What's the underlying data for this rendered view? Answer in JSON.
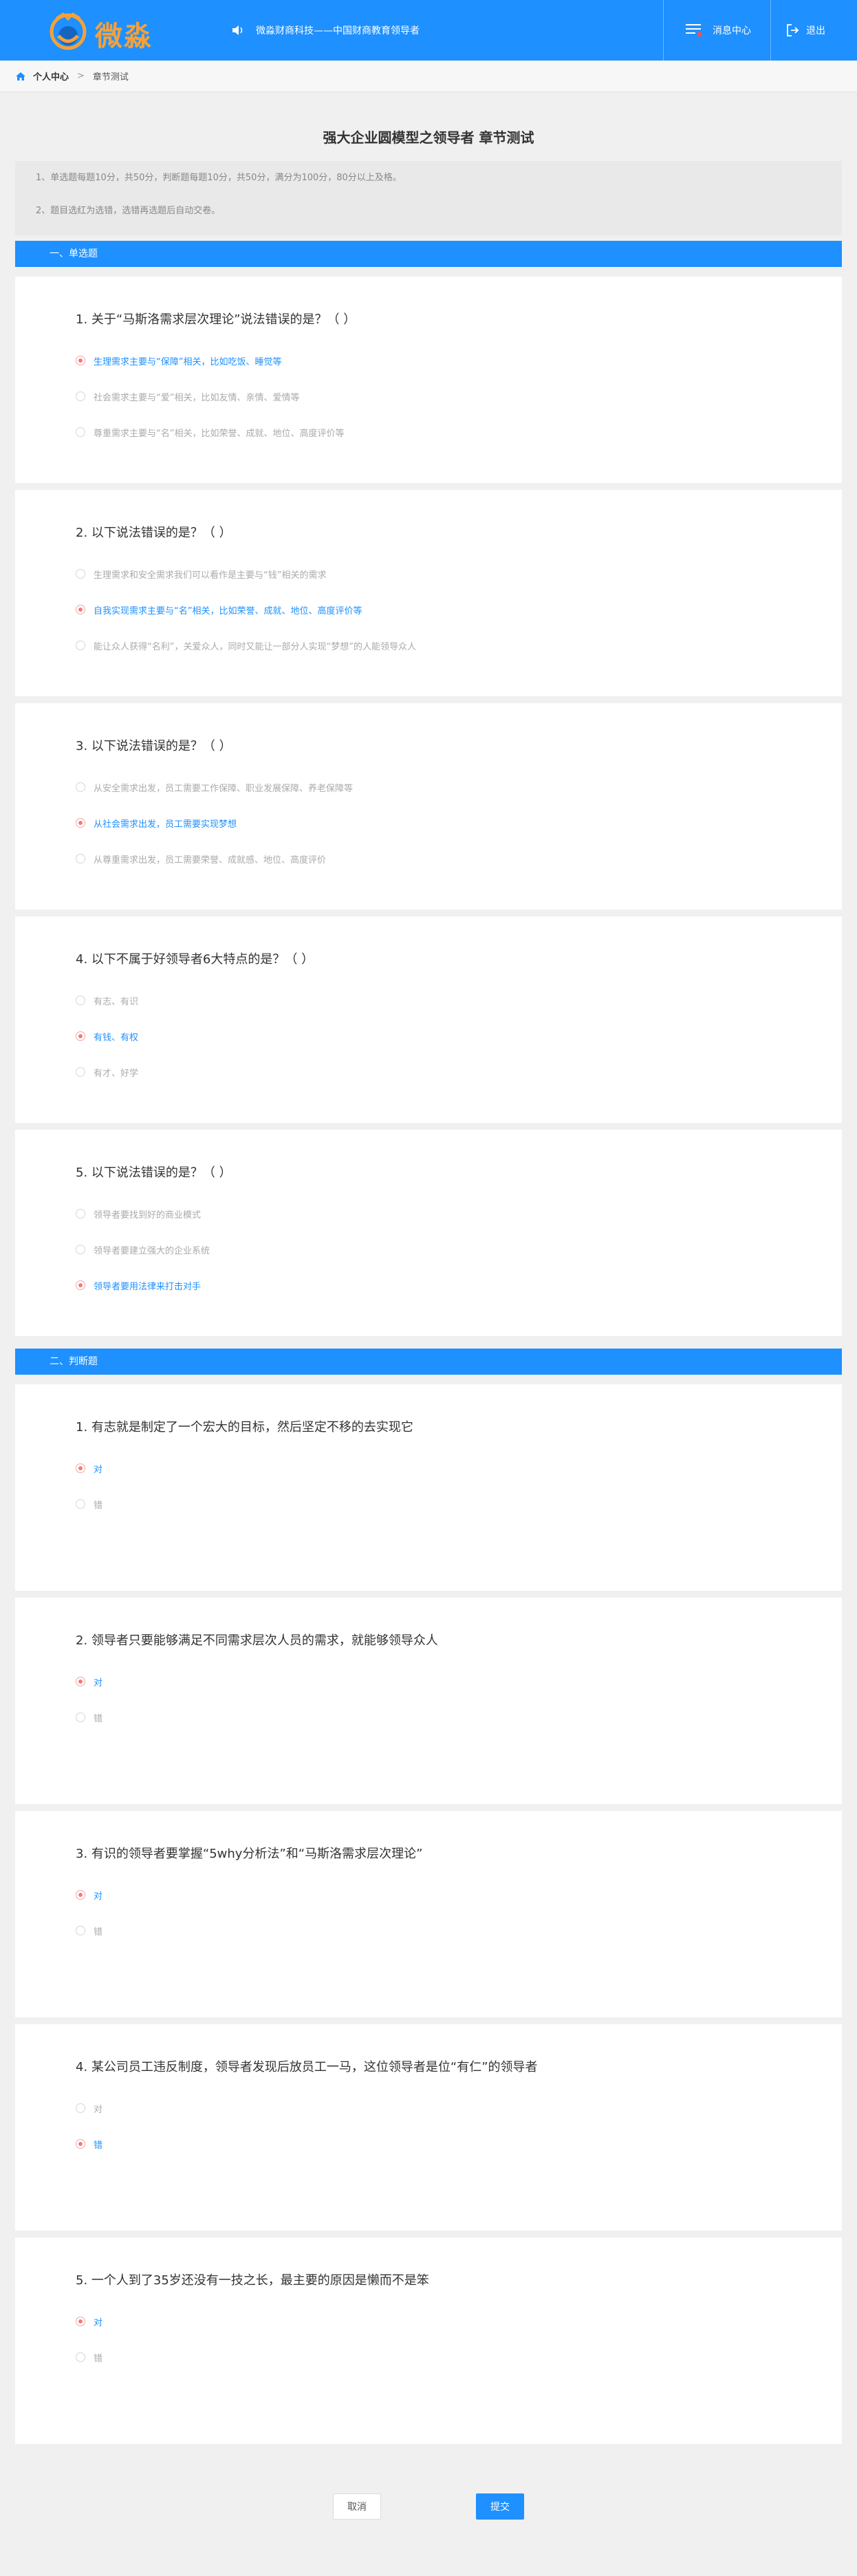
{
  "header": {
    "logo_text": "微淼",
    "marquee": "微淼财商科技——中国财商教育领导者",
    "messages_label": "消息中心",
    "logout_label": "退出",
    "brand_color": "#1e90ff",
    "logo_color": "#f4a13a"
  },
  "breadcrumb": {
    "home": "个人中心",
    "separator": ">",
    "current": "章节测试"
  },
  "page_title": "强大企业圆模型之领导者 章节测试",
  "notice": [
    "1、单选题每题10分，共50分，判断题每题10分，共50分，满分为100分，80分以上及格。",
    "2、题目选红为选错，选错再选题后自动交卷。"
  ],
  "sections": [
    {
      "title": "一、单选题",
      "questions": [
        {
          "title": "1. 关于“马斯洛需求层次理论”说法错误的是？（ ）",
          "options": [
            {
              "label": "生理需求主要与“保障”相关，比如吃饭、睡觉等",
              "selected": true
            },
            {
              "label": "社会需求主要与“爱”相关，比如友情、亲情、爱情等",
              "selected": false
            },
            {
              "label": "尊重需求主要与“名”相关，比如荣誉、成就、地位、高度评价等",
              "selected": false
            }
          ]
        },
        {
          "title": "2. 以下说法错误的是？（ ）",
          "options": [
            {
              "label": "生理需求和安全需求我们可以看作是主要与“钱”相关的需求",
              "selected": false
            },
            {
              "label": "自我实现需求主要与“名”相关，比如荣誉、成就、地位、高度评价等",
              "selected": true
            },
            {
              "label": "能让众人获得“名利”，关爱众人，同时又能让一部分人实现“梦想”的人能领导众人",
              "selected": false
            }
          ]
        },
        {
          "title": "3. 以下说法错误的是？（ ）",
          "options": [
            {
              "label": "从安全需求出发，员工需要工作保障、职业发展保障、养老保障等",
              "selected": false
            },
            {
              "label": "从社会需求出发，员工需要实现梦想",
              "selected": true
            },
            {
              "label": "从尊重需求出发，员工需要荣誉、成就感、地位、高度评价",
              "selected": false
            }
          ]
        },
        {
          "title": "4. 以下不属于好领导者6大特点的是？（ ）",
          "options": [
            {
              "label": "有志、有识",
              "selected": false
            },
            {
              "label": "有钱、有权",
              "selected": true
            },
            {
              "label": "有才、好学",
              "selected": false
            }
          ]
        },
        {
          "title": "5. 以下说法错误的是？（ ）",
          "options": [
            {
              "label": "领导者要找到好的商业模式",
              "selected": false
            },
            {
              "label": "领导者要建立强大的企业系统",
              "selected": false
            },
            {
              "label": "领导者要用法律来打击对手",
              "selected": true
            }
          ]
        }
      ]
    },
    {
      "title": "二、判断题",
      "questions": [
        {
          "title": "1. 有志就是制定了一个宏大的目标，然后坚定不移的去实现它",
          "options": [
            {
              "label": "对",
              "selected": true
            },
            {
              "label": "错",
              "selected": false
            }
          ]
        },
        {
          "title": "2. 领导者只要能够满足不同需求层次人员的需求，就能够领导众人",
          "options": [
            {
              "label": "对",
              "selected": true
            },
            {
              "label": "错",
              "selected": false
            }
          ]
        },
        {
          "title": "3. 有识的领导者要掌握“5why分析法”和“马斯洛需求层次理论”",
          "options": [
            {
              "label": "对",
              "selected": true
            },
            {
              "label": "错",
              "selected": false
            }
          ]
        },
        {
          "title": "4. 某公司员工违反制度，领导者发现后放员工一马，这位领导者是位“有仁”的领导者",
          "options": [
            {
              "label": "对",
              "selected": false
            },
            {
              "label": "错",
              "selected": true
            }
          ]
        },
        {
          "title": "5. 一个人到了35岁还没有一技之长，最主要的原因是懒而不是笨",
          "options": [
            {
              "label": "对",
              "selected": true
            },
            {
              "label": "错",
              "selected": false
            }
          ]
        }
      ]
    }
  ],
  "buttons": {
    "cancel": "取消",
    "submit": "提交"
  }
}
